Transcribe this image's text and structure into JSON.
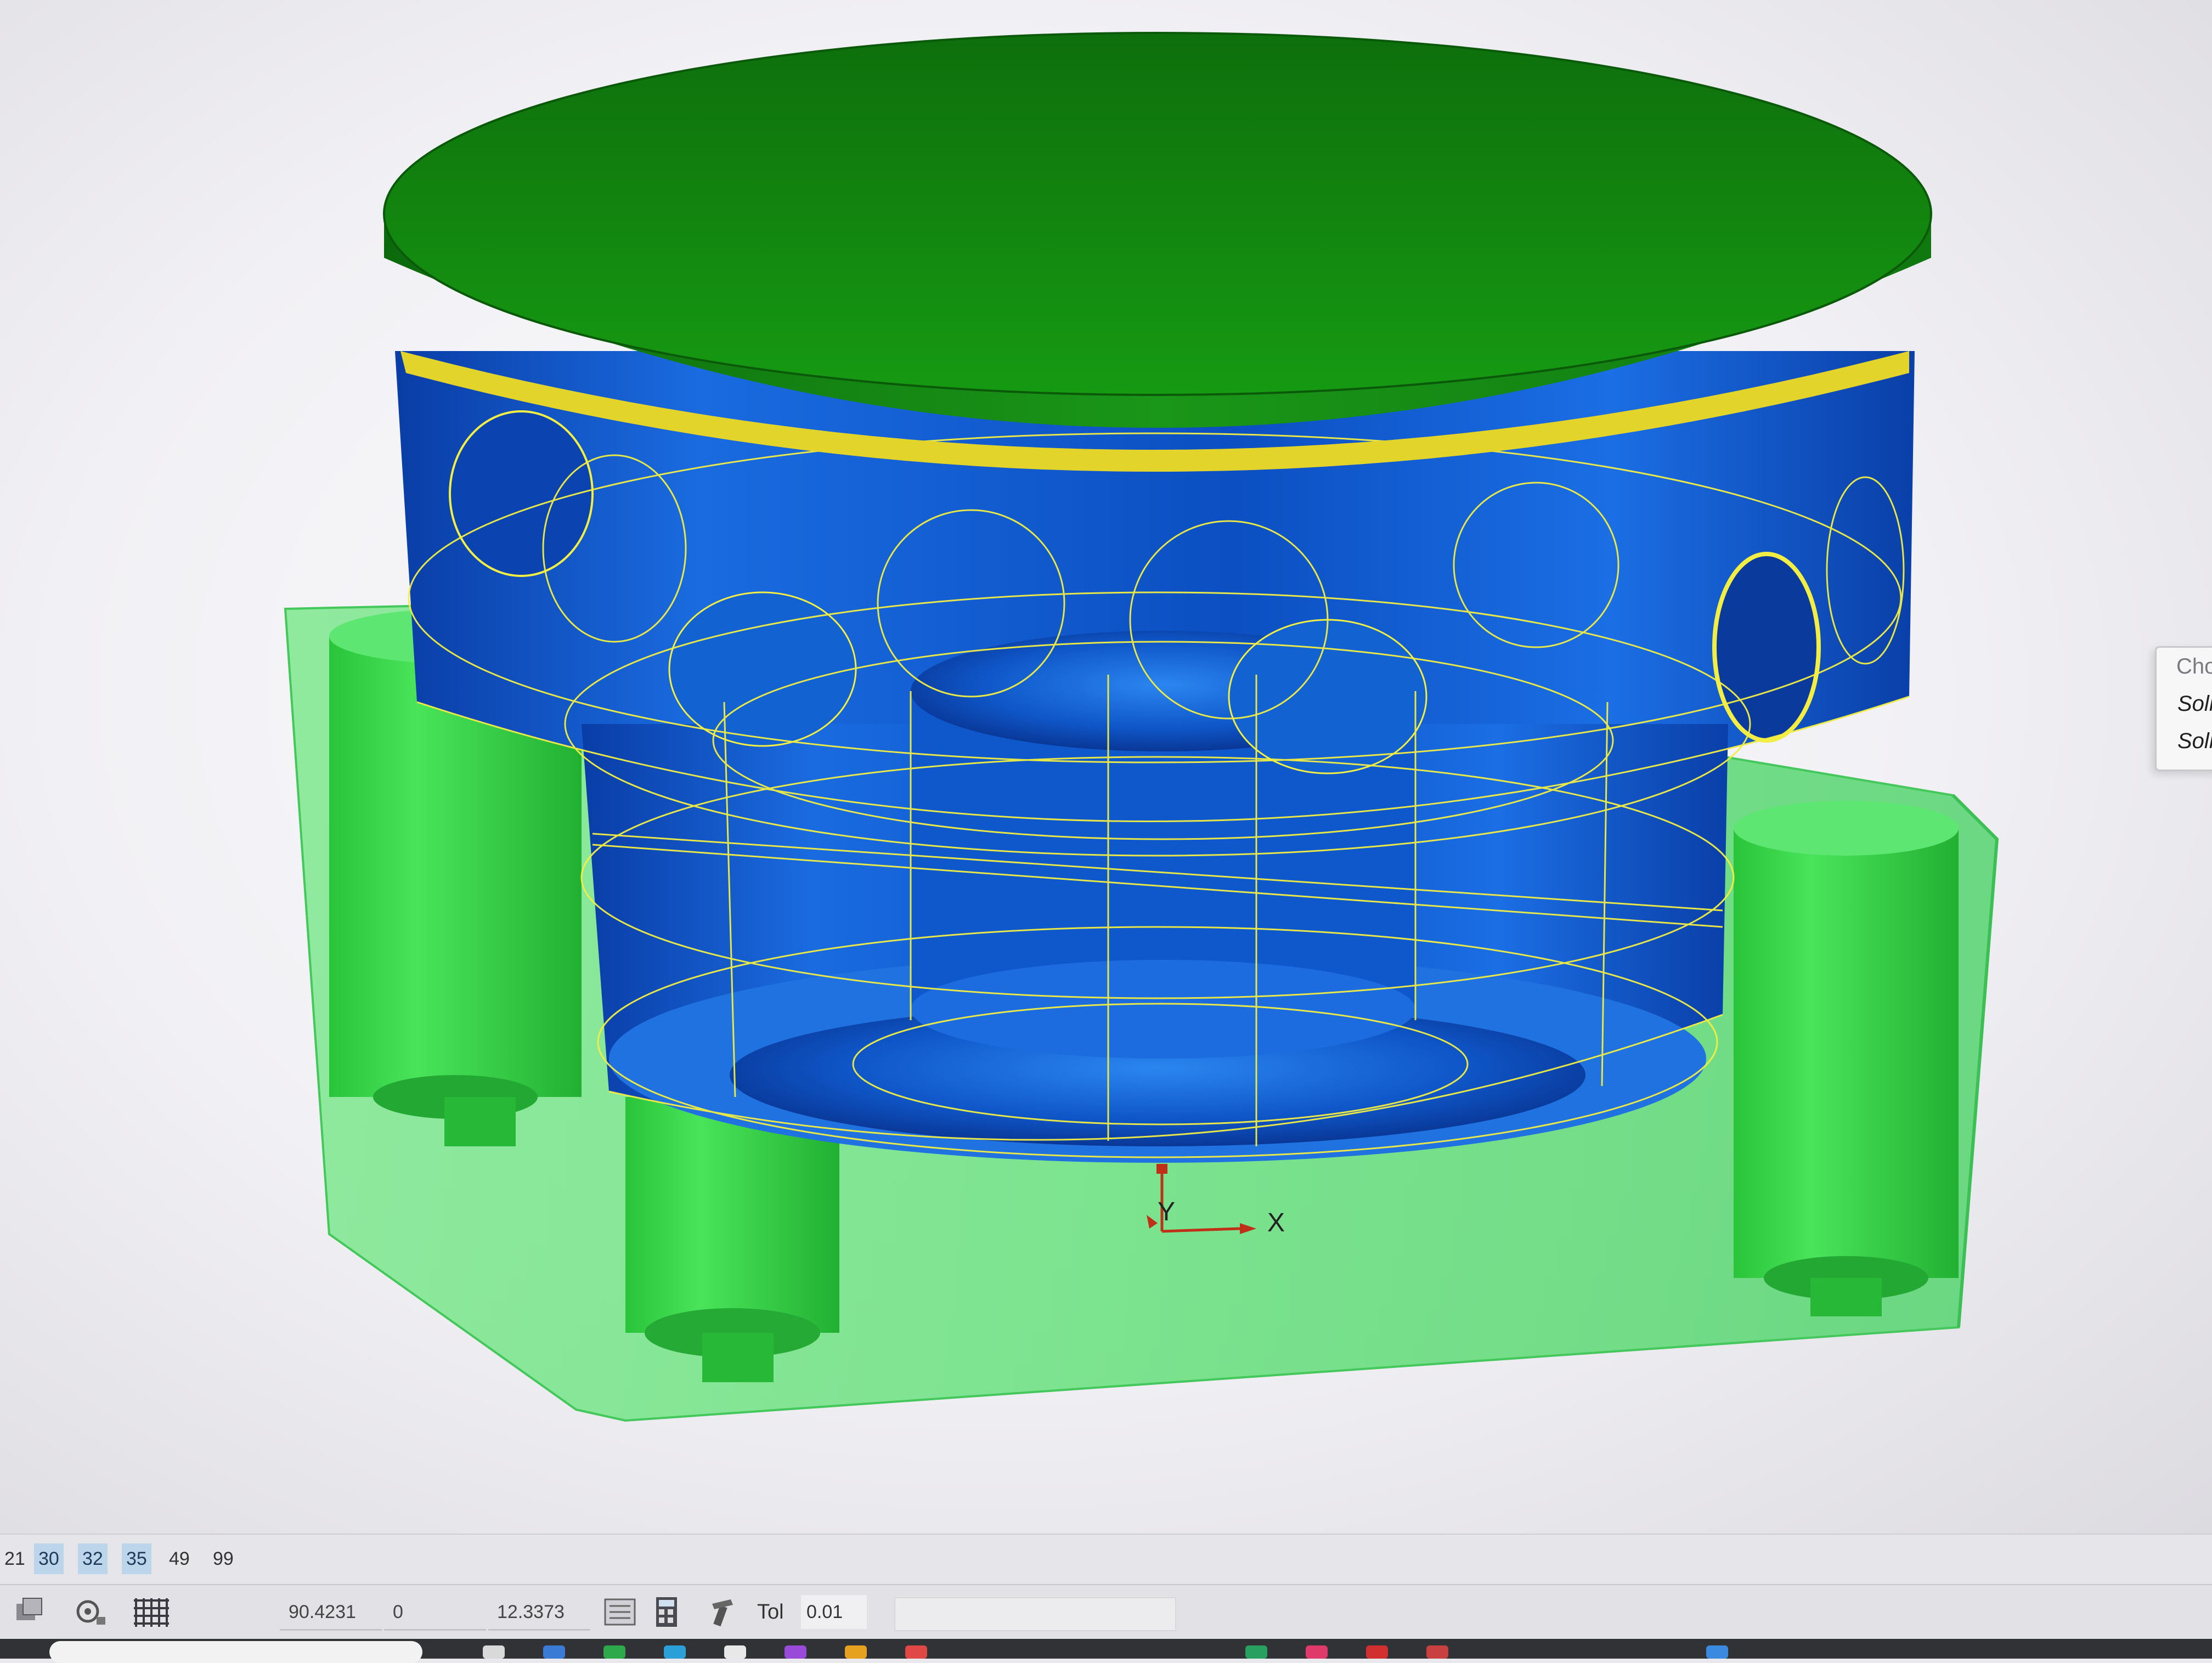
{
  "viewport": {
    "axis_x_label": "X",
    "axis_y_label": "Y",
    "colors": {
      "background": "#f4f3f7",
      "lid": "#169a12",
      "ring": "#e0d42a",
      "part_blue": "#0d56c8",
      "wireframe": "#f2ee43",
      "fixture": "#5ee07a"
    }
  },
  "context_menu": {
    "header": "Cho",
    "items": [
      "Soli",
      "Soli"
    ]
  },
  "layer_bar": {
    "items": [
      {
        "label": "21",
        "selected": false
      },
      {
        "label": "30",
        "selected": true
      },
      {
        "label": "32",
        "selected": true
      },
      {
        "label": "35",
        "selected": true
      },
      {
        "label": "49",
        "selected": false
      },
      {
        "label": "99",
        "selected": false
      }
    ]
  },
  "status_bar": {
    "icons": [
      "layer-icon",
      "view-settings-icon",
      "grid-icon",
      "list-icon",
      "calculator-icon",
      "tool-icon"
    ],
    "coord_1": "90.4231",
    "coord_2": "0",
    "coord_3": "12.3373",
    "tol_label": "Tol",
    "tol_value": "0.01"
  }
}
